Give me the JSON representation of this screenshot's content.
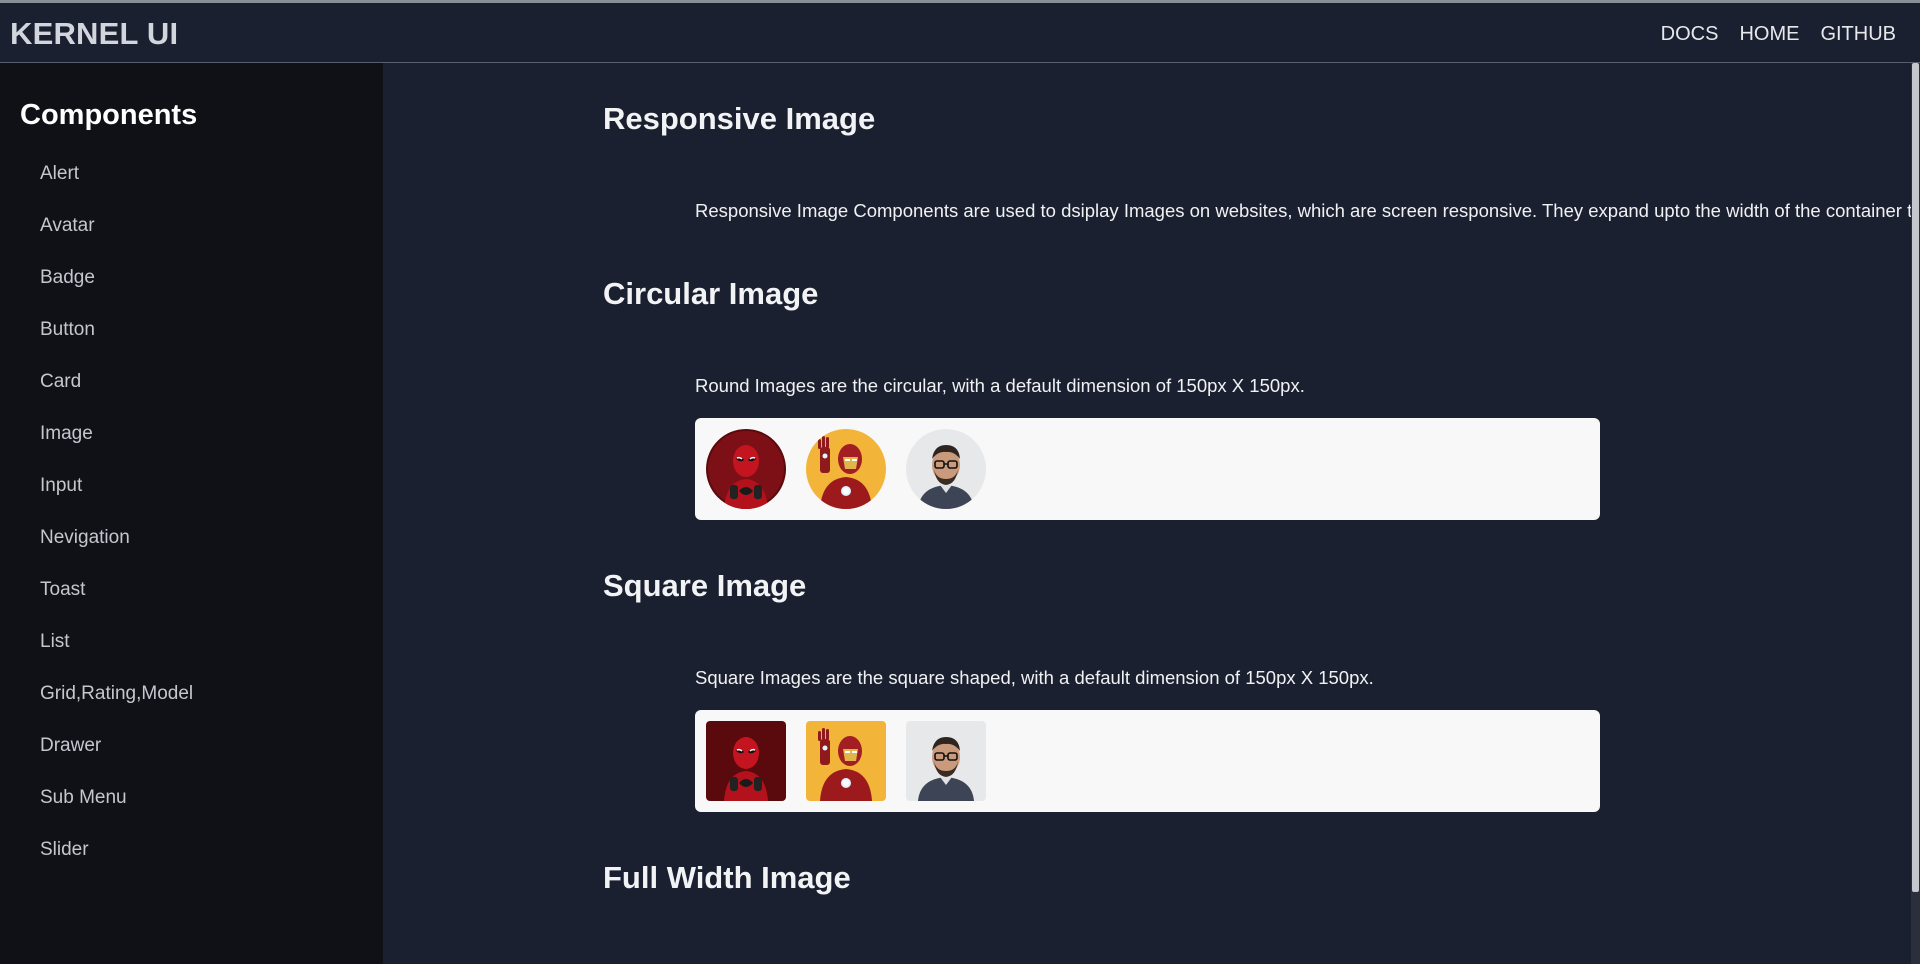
{
  "header": {
    "brand": "KERNEL UI",
    "nav": [
      "DOCS",
      "HOME",
      "GITHUB"
    ]
  },
  "sidebar": {
    "title": "Components",
    "items": [
      "Alert",
      "Avatar",
      "Badge",
      "Button",
      "Card",
      "Image",
      "Input",
      "Nevigation",
      "Toast",
      "List",
      "Grid,Rating,Model",
      "Drawer",
      "Sub Menu",
      "Slider"
    ]
  },
  "sections": {
    "responsive": {
      "title": "Responsive Image",
      "desc": "Responsive Image Components are used to dsiplay Images on websites, which are screen responsive. They expand upto the width of the container they are in."
    },
    "circular": {
      "title": "Circular Image",
      "desc": "Round Images are the circular, with a default dimension of 150px X 150px.",
      "images": [
        "deadpool-image",
        "iron-man-image",
        "man-with-glasses-image"
      ]
    },
    "square": {
      "title": "Square Image",
      "desc": "Square Images are the square shaped, with a default dimension of 150px X 150px.",
      "images": [
        "deadpool-image",
        "iron-man-image",
        "man-with-glasses-image"
      ]
    },
    "fullwidth": {
      "title": "Full Width Image"
    }
  },
  "colors": {
    "background": "#1b2030",
    "sidebar": "#0f1117",
    "image_box": "#f8f8f8"
  }
}
